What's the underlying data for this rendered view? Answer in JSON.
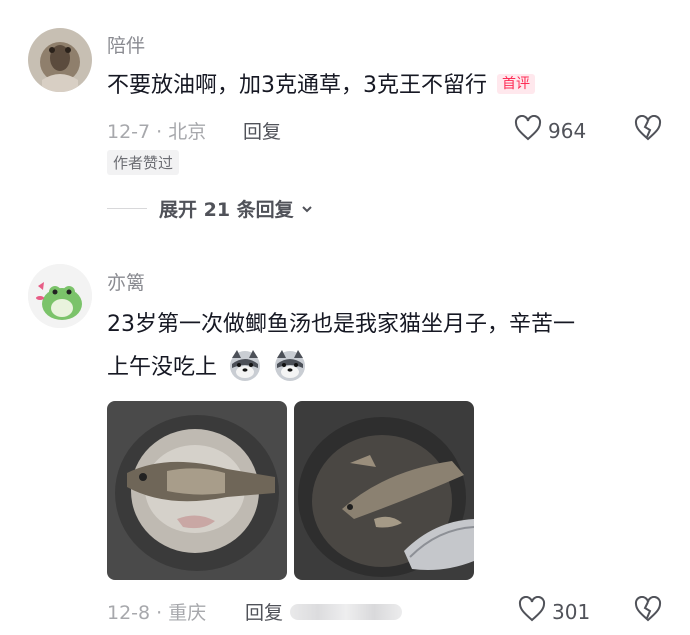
{
  "comments": [
    {
      "username": "陪伴",
      "text": "不要放油啊，加3克通草，3克王不留行",
      "badge": "首评",
      "date_location": "12-7 · 北京",
      "reply_label": "回复",
      "likes": "964",
      "author_liked": "作者赞过",
      "expand_label": "展开 21 条回复"
    },
    {
      "username": "亦篱",
      "text_line1": "23岁第一次做鲫鱼汤也是我家猫坐月子，辛苦一",
      "text_line2": "上午没吃上",
      "emoji_count": 2,
      "date_location": "12-8 · 重庆",
      "reply_label": "回复",
      "likes": "301"
    }
  ],
  "icons": {
    "like": "heart-outline-icon",
    "dislike": "broken-heart-icon",
    "expand": "chevron-down-icon",
    "emoji": "husky-emoji-icon"
  },
  "colors": {
    "badge_red": "#fe2c55",
    "secondary_text": "#a7a8ac",
    "primary_text": "#161823"
  }
}
